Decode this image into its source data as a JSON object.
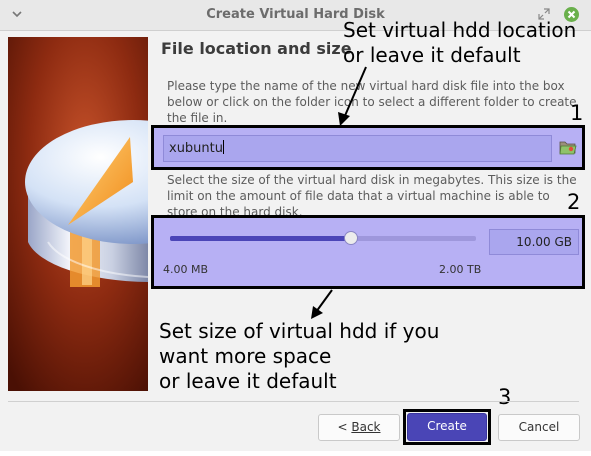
{
  "window": {
    "title": "Create Virtual Hard Disk"
  },
  "header": {
    "title": "File location and size"
  },
  "file_location": {
    "description": "Please type the name of the new virtual hard disk file into the box below or click on the folder icon to select a different folder to create the file in.",
    "value": "xubuntu"
  },
  "file_size": {
    "description": "Select the size of the virtual hard disk in megabytes. This size is the limit on the amount of file data that a virtual machine is able to store on the hard disk.",
    "value": "10.00 GB",
    "min_label": "4.00 MB",
    "max_label": "2.00 TB",
    "slider_fraction": 0.59
  },
  "annotations": {
    "location_line1": "Set virtual hdd location",
    "location_line2": "or leave it default",
    "size_line1": "Set size of virtual hdd if you",
    "size_line2": "want more space",
    "size_line3": "or leave it default",
    "marker1": "1",
    "marker2": "2",
    "marker3": "3"
  },
  "buttons": {
    "back_prefix": "< ",
    "back_label": "Back",
    "create_label": "Create",
    "cancel_label": "Cancel"
  },
  "colors": {
    "highlight": "#b7b0f4",
    "accent": "#4a45b6",
    "close_button": "#6ab04c"
  },
  "icons": {
    "title_menu": "chevron-down-icon",
    "restore": "restore-icon",
    "close": "close-icon",
    "folder": "folder-open-icon"
  }
}
